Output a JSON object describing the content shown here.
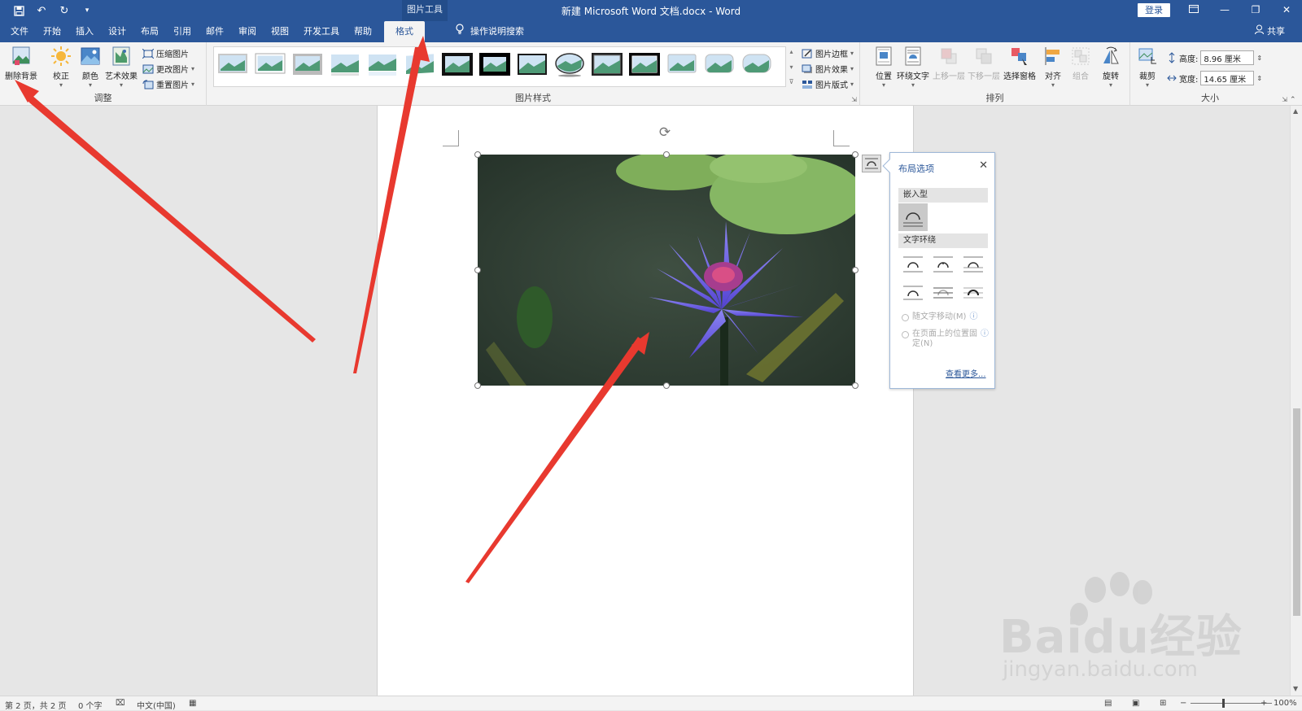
{
  "titlebar": {
    "context_tab": "图片工具",
    "title": "新建 Microsoft Word 文档.docx  -  Word",
    "login": "登录"
  },
  "tabs": [
    "文件",
    "开始",
    "插入",
    "设计",
    "布局",
    "引用",
    "邮件",
    "审阅",
    "视图",
    "开发工具",
    "帮助",
    "格式"
  ],
  "tell_me": "操作说明搜索",
  "share": "共享",
  "ribbon": {
    "adjust": {
      "label": "调整",
      "remove_bg": "删除背景",
      "correct": "校正",
      "color": "颜色",
      "artistic": "艺术效果",
      "compress": "压缩图片",
      "change": "更改图片",
      "reset": "重置图片"
    },
    "styles": {
      "label": "图片样式",
      "border": "图片边框",
      "effects": "图片效果",
      "layout": "图片版式"
    },
    "arrange": {
      "label": "排列",
      "position": "位置",
      "wrap": "环绕文字",
      "forward": "上移一层",
      "backward": "下移一层",
      "selection": "选择窗格",
      "align": "对齐",
      "group": "组合",
      "rotate": "旋转"
    },
    "size": {
      "label": "大小",
      "crop": "裁剪",
      "height_label": "高度:",
      "height_value": "8.96 厘米",
      "width_label": "宽度:",
      "width_value": "14.65 厘米"
    }
  },
  "layout_popup": {
    "title": "布局选项",
    "inline_section": "嵌入型",
    "wrap_section": "文字环绕",
    "move_with_text": "随文字移动(M)",
    "fix_position": "在页面上的位置固定(N)",
    "see_more": "查看更多..."
  },
  "status": {
    "page": "第 2 页，共 2 页",
    "words": "0 个字",
    "language": "中文(中国)",
    "zoom": "100%"
  },
  "watermark": {
    "brand": "Baidu经验",
    "url": "jingyan.baidu.com"
  },
  "colors": {
    "accent": "#2b579a",
    "arrow": "#e8392f",
    "flower": "#6d5ae0",
    "pond": "#2f3d31"
  }
}
